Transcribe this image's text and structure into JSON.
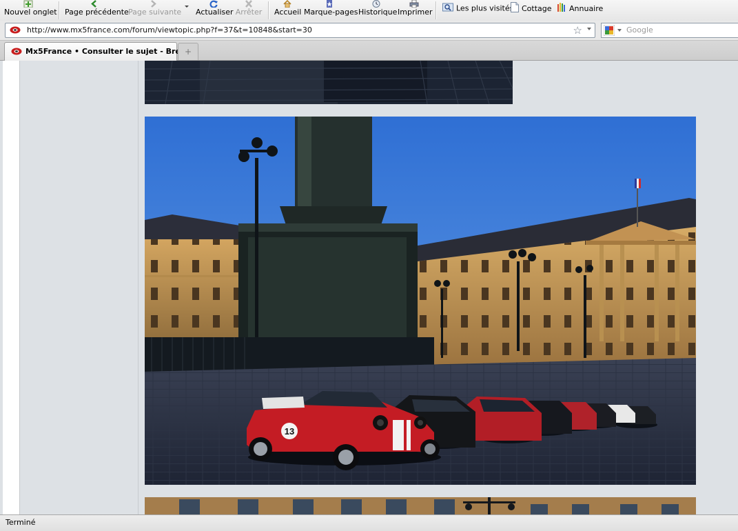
{
  "toolbar": {
    "new_tab": "Nouvel onglet",
    "back": "Page précédente",
    "forward": "Page suivante",
    "reload": "Actualiser",
    "stop": "Arrêter",
    "home": "Accueil",
    "bookmarks": "Marque-pages",
    "history": "Historique",
    "print": "Imprimer"
  },
  "bookmarks_bar": {
    "most_visited": "Les plus visités",
    "cottage": "Cottage",
    "directory": "Annuaire"
  },
  "address_bar": {
    "url": "http://www.mx5france.com/forum/viewtopic.php?f=37&t=10848&start=30"
  },
  "search_bar": {
    "placeholder": "Google"
  },
  "tabs": [
    {
      "label": "Mx5France • Consulter le sujet - Bre..."
    }
  ],
  "status": {
    "text": "Terminé"
  },
  "colors": {
    "accent_red": "#cc1e1e",
    "sky_blue": "#3a7ad8",
    "building_gold": "#c79a55"
  },
  "icons": {
    "new_tab": "plus-icon",
    "back": "back-arrow-icon",
    "forward": "forward-arrow-icon",
    "reload": "reload-icon",
    "stop": "stop-icon",
    "home": "home-icon",
    "bookmarks": "bookmark-star-icon",
    "history": "clock-icon",
    "print": "printer-icon"
  }
}
